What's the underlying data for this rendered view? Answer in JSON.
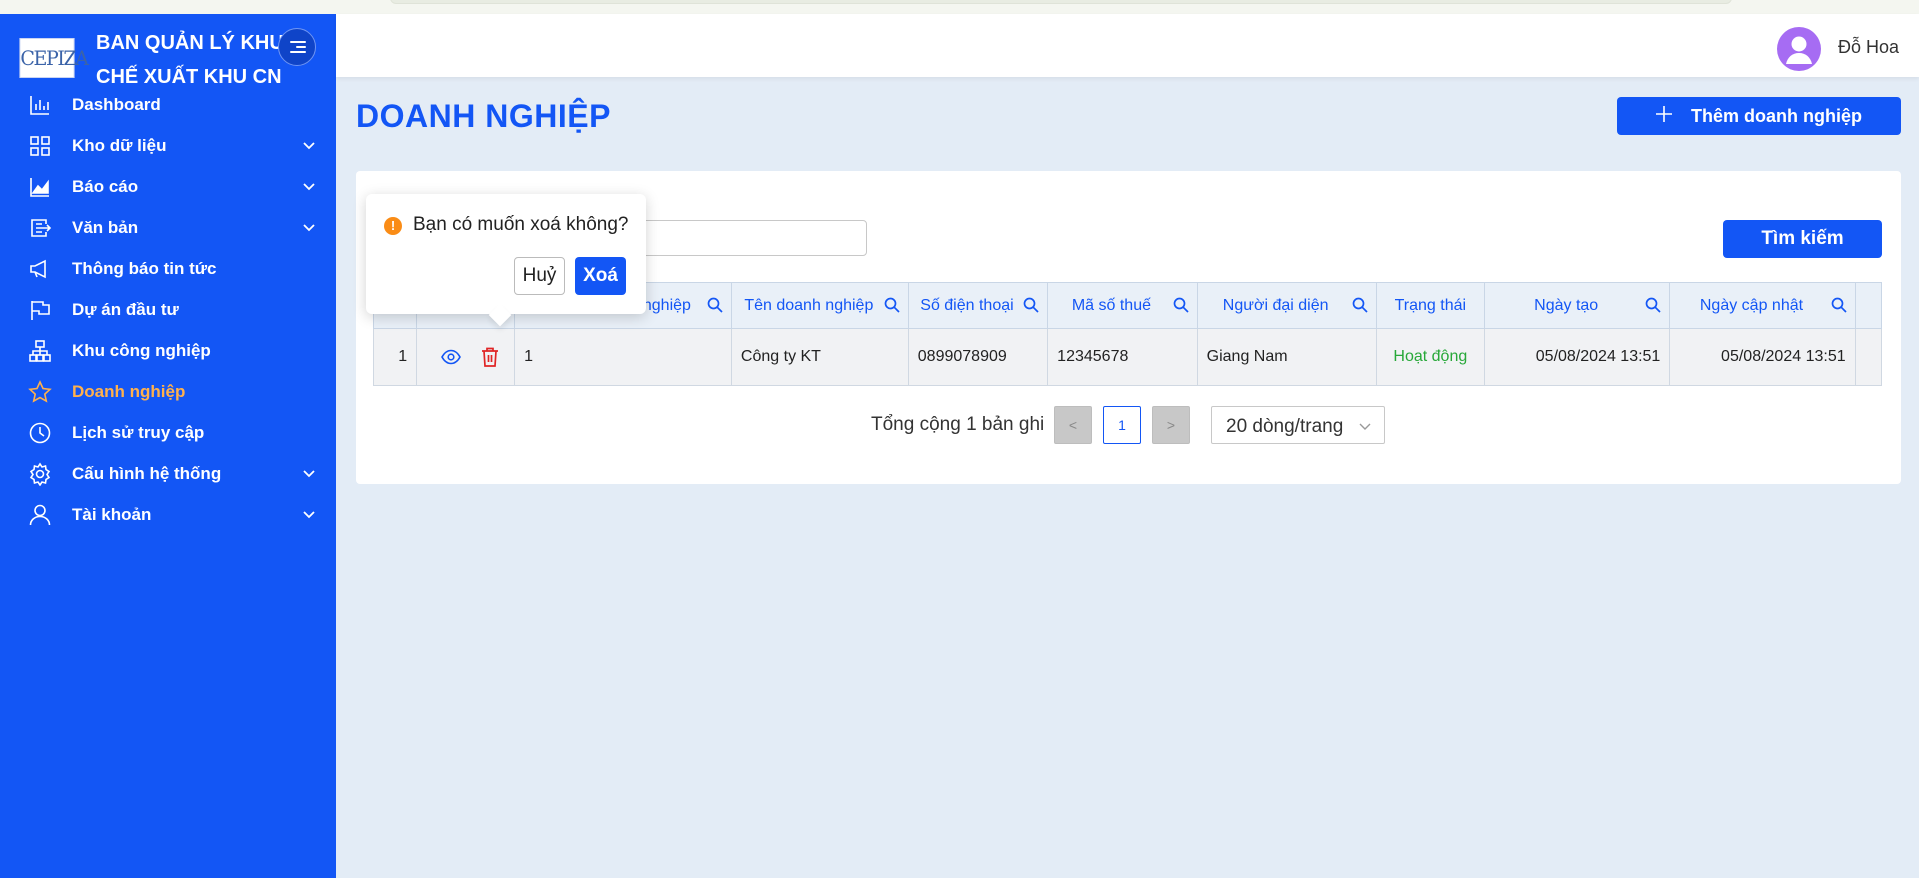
{
  "brand": {
    "logo_text": "CEPIZA",
    "title_line1": "BAN QUẢN LÝ KHU",
    "title_line2": "CHẾ XUẤT KHU CN"
  },
  "sidebar": {
    "items": [
      {
        "label": "Dashboard",
        "icon": "bar-chart-icon",
        "has_submenu": false
      },
      {
        "label": "Kho dữ liệu",
        "icon": "grid-icon",
        "has_submenu": true
      },
      {
        "label": "Báo cáo",
        "icon": "area-chart-icon",
        "has_submenu": true
      },
      {
        "label": "Văn bản",
        "icon": "document-export-icon",
        "has_submenu": true
      },
      {
        "label": "Thông báo tin tức",
        "icon": "megaphone-icon",
        "has_submenu": false
      },
      {
        "label": "Dự án đầu tư",
        "icon": "flag-icon",
        "has_submenu": false
      },
      {
        "label": "Khu công nghiệp",
        "icon": "cluster-icon",
        "has_submenu": false
      },
      {
        "label": "Doanh nghiệp",
        "icon": "star-icon",
        "has_submenu": false,
        "active": true
      },
      {
        "label": "Lịch sử truy cập",
        "icon": "clock-icon",
        "has_submenu": false
      },
      {
        "label": "Cấu hình hệ thống",
        "icon": "gear-icon",
        "has_submenu": true
      },
      {
        "label": "Tài khoản",
        "icon": "user-icon",
        "has_submenu": true
      }
    ],
    "active_color": "#ffb14d"
  },
  "header": {
    "username": "Đỗ Hoa"
  },
  "main": {
    "page_title": "DOANH NGHIỆP",
    "add_button_label": "Thêm doanh nghiệp",
    "search_input_value": "",
    "search_button_label": "Tìm kiếm"
  },
  "table": {
    "columns": [
      {
        "label": "",
        "searchable": false
      },
      {
        "label": "",
        "searchable": false
      },
      {
        "label": "nghiệp",
        "searchable": true
      },
      {
        "label": "Tên doanh nghiệp",
        "searchable": true
      },
      {
        "label": "Số điện thoại",
        "searchable": true
      },
      {
        "label": "Mã số thuế",
        "searchable": true
      },
      {
        "label": "Người đại diện",
        "searchable": true
      },
      {
        "label": "Trạng thái",
        "searchable": false
      },
      {
        "label": "Ngày tạo",
        "searchable": true
      },
      {
        "label": "Ngày cập nhật",
        "searchable": true
      }
    ],
    "rows": [
      {
        "stt": "1",
        "ma": "1",
        "ten": "Công ty KT",
        "sdt": "0899078909",
        "mst": "12345678",
        "nguoi_dai_dien": "Giang Nam",
        "trang_thai": "Hoạt động",
        "ngay_tao": "05/08/2024 13:51",
        "ngay_cap_nhat": "05/08/2024 13:51"
      }
    ],
    "status_color": "#27a838"
  },
  "pagination": {
    "total_text": "Tổng cộng 1 bản ghi",
    "prev": "<",
    "current_page": "1",
    "next": ">",
    "page_size": "20 dòng/trang"
  },
  "popconfirm": {
    "warning_glyph": "!",
    "message": "Bạn có muốn xoá không?",
    "cancel_label": "Huỷ",
    "ok_label": "Xoá"
  },
  "colors": {
    "primary": "#1356f5",
    "warning": "#fa8c16",
    "danger": "#e02424"
  }
}
